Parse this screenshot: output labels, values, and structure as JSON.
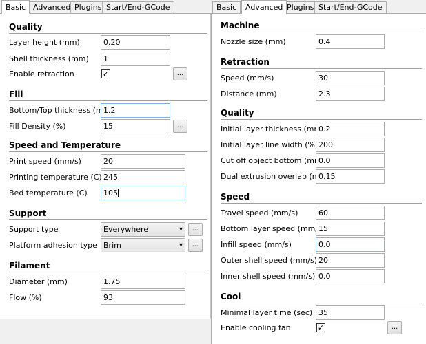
{
  "left": {
    "tabs": [
      "Basic",
      "Advanced",
      "Plugins",
      "Start/End-GCode"
    ],
    "quality": {
      "title": "Quality",
      "layer_height_label": "Layer height (mm)",
      "layer_height": "0.20",
      "shell_thickness_label": "Shell thickness (mm)",
      "shell_thickness": "1",
      "enable_retraction_label": "Enable retraction",
      "enable_retraction_checked": "✓"
    },
    "fill": {
      "title": "Fill",
      "bottom_top_label": "Bottom/Top thickness (mm)",
      "bottom_top": "1.2",
      "density_label": "Fill Density (%)",
      "density": "15"
    },
    "speed_temp": {
      "title": "Speed and Temperature",
      "print_speed_label": "Print speed (mm/s)",
      "print_speed": "20",
      "print_temp_label": "Printing temperature (C)",
      "print_temp": "245",
      "bed_temp_label": "Bed temperature (C)",
      "bed_temp": "105"
    },
    "support": {
      "title": "Support",
      "type_label": "Support type",
      "type": "Everywhere",
      "adhesion_label": "Platform adhesion type",
      "adhesion": "Brim"
    },
    "filament": {
      "title": "Filament",
      "diameter_label": "Diameter (mm)",
      "diameter": "1.75",
      "flow_label": "Flow (%)",
      "flow": "93"
    },
    "more_button": "..."
  },
  "right": {
    "tabs": [
      "Basic",
      "Advanced",
      "Plugins",
      "Start/End-GCode"
    ],
    "machine": {
      "title": "Machine",
      "nozzle_label": "Nozzle size (mm)",
      "nozzle": "0.4"
    },
    "retraction": {
      "title": "Retraction",
      "speed_label": "Speed (mm/s)",
      "speed": "30",
      "distance_label": "Distance (mm)",
      "distance": "2.3"
    },
    "quality": {
      "title": "Quality",
      "initial_thickness_label": "Initial layer thickness (mm)",
      "initial_thickness": "0.2",
      "initial_width_label": "Initial layer line width (%)",
      "initial_width": "200",
      "cut_off_label": "Cut off object bottom (mm)",
      "cut_off": "0.0",
      "dual_overlap_label": "Dual extrusion overlap (mm)",
      "dual_overlap": "0.15"
    },
    "speed": {
      "title": "Speed",
      "travel_label": "Travel speed (mm/s)",
      "travel": "60",
      "bottom_layer_label": "Bottom layer speed (mm/s)",
      "bottom_layer": "15",
      "infill_label": "Infill speed (mm/s)",
      "infill": "0.0",
      "outer_shell_label": "Outer shell speed (mm/s)",
      "outer_shell": "20",
      "inner_shell_label": "Inner shell speed (mm/s)",
      "inner_shell": "0.0"
    },
    "cool": {
      "title": "Cool",
      "min_layer_time_label": "Minimal layer time (sec)",
      "min_layer_time": "35",
      "fan_label": "Enable cooling fan",
      "fan_checked": "✓"
    },
    "more_button": "..."
  },
  "icons": {
    "dropdown": "▾"
  }
}
